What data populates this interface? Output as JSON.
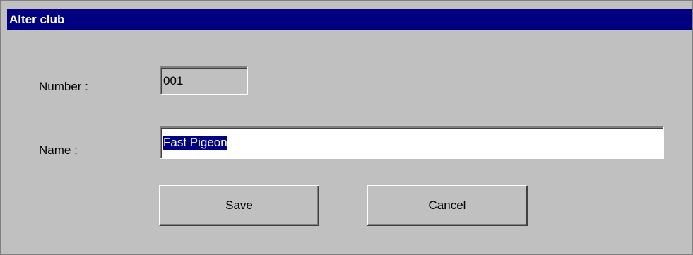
{
  "window": {
    "title": "Alter club"
  },
  "form": {
    "number_label": "Number :",
    "number_value": "001",
    "name_label": "Name :",
    "name_value": "Fast Pigeon"
  },
  "buttons": {
    "save_label": "Save",
    "cancel_label": "Cancel"
  },
  "colors": {
    "titlebar": "#000080",
    "dialog_face": "#c0c0c0",
    "selection": "#000080"
  }
}
